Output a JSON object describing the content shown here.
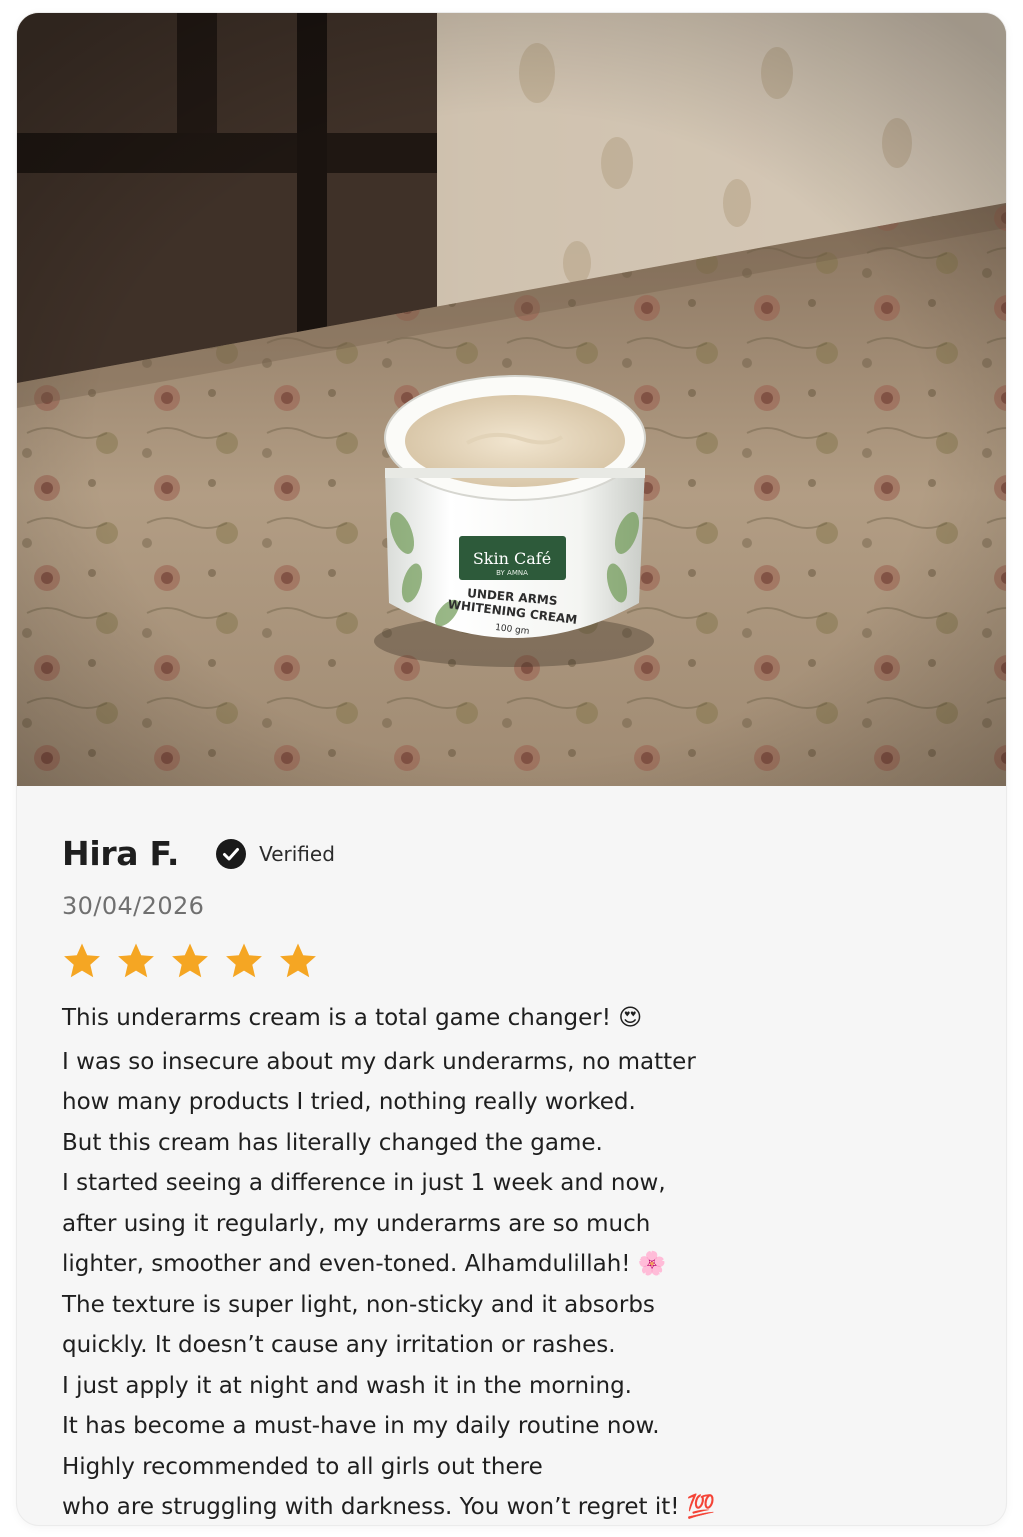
{
  "review": {
    "photo": {
      "alt": "Skin Café by Amna Under Arms Whitening Cream jar on a floral tablecloth",
      "label_brand": "Skin Café",
      "label_sub": "BY AMNA",
      "label_product_line1": "UNDER ARMS",
      "label_product_line2": "WHITENING CREAM",
      "label_weight": "100 gm"
    },
    "reviewer_name": "Hira F.",
    "verified_label": "Verified",
    "date": "30/04/2026",
    "rating": 5,
    "rating_max": 5,
    "star_color": "#f5a623",
    "lines": [
      "This underarms cream is a total game changer! 😍",
      "I was so insecure about my dark underarms, no matter",
      "how many products I tried, nothing really worked.",
      "But this cream has literally changed the game.",
      "I started seeing a difference in just 1 week and now,",
      "after using it regularly, my underarms are so much",
      "lighter, smoother and even-toned. Alhamdulillah! 🌸",
      "The texture is super light, non-sticky and it absorbs",
      "quickly. It doesn’t cause any irritation or rashes.",
      "I just apply it at night and wash it in the morning.",
      "It has become a must-have in my daily routine now.",
      "Highly recommended to all girls out there",
      "who are struggling with darkness. You won’t regret it! 💯"
    ]
  }
}
